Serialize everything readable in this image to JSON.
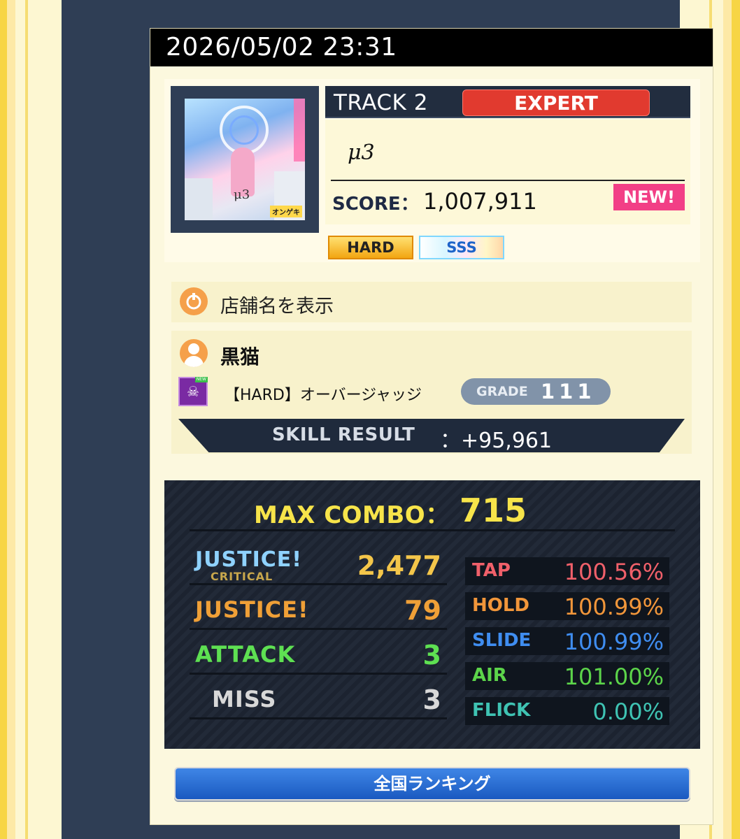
{
  "play": {
    "datetime": "2026/05/02 23:31"
  },
  "track": {
    "label": "TRACK 2",
    "difficulty": "EXPERT",
    "title": "μ3",
    "score_label": "SCORE：",
    "score": "1,007,911",
    "new_badge": "NEW!",
    "clear_lamp": "HARD",
    "rank": "SSS",
    "jacket": {
      "art_text": "μ3",
      "logo_text": "オンゲキ"
    }
  },
  "shop": {
    "label": "店舗名を表示"
  },
  "player": {
    "name": "黒猫",
    "skill_name": "【HARD】オーバージャッジ",
    "skill_icon_text": "☠",
    "skill_icon_tag": "NEW",
    "grade_label": "GRADE",
    "grade_value": "111",
    "skill_result_label": "SKILL RESULT",
    "skill_result_value": "：+95,961"
  },
  "combo": {
    "max_combo_label": "MAX COMBO：",
    "max_combo_value": "715"
  },
  "judgments": [
    {
      "name": "JUSTICE!",
      "sub": "CRITICAL",
      "value": "2,477",
      "color": "#f4c64a"
    },
    {
      "name": "JUSTICE!",
      "value": "79",
      "color": "#f0a037"
    },
    {
      "name": "ATTACK",
      "value": "3",
      "color": "#5ee052"
    },
    {
      "name": "MISS",
      "value": "3",
      "color": "#d8d8d8"
    }
  ],
  "rates": [
    {
      "name": "TAP",
      "value": "100.56%",
      "color": "#f0606a"
    },
    {
      "name": "HOLD",
      "value": "100.99%",
      "color": "#f1963a"
    },
    {
      "name": "SLIDE",
      "value": "100.99%",
      "color": "#3f8df0"
    },
    {
      "name": "AIR",
      "value": "101.00%",
      "color": "#5cd44a"
    },
    {
      "name": "FLICK",
      "value": "0.00%",
      "color": "#3fc3b3"
    }
  ],
  "ranking": {
    "button_label": "全国ランキング"
  }
}
